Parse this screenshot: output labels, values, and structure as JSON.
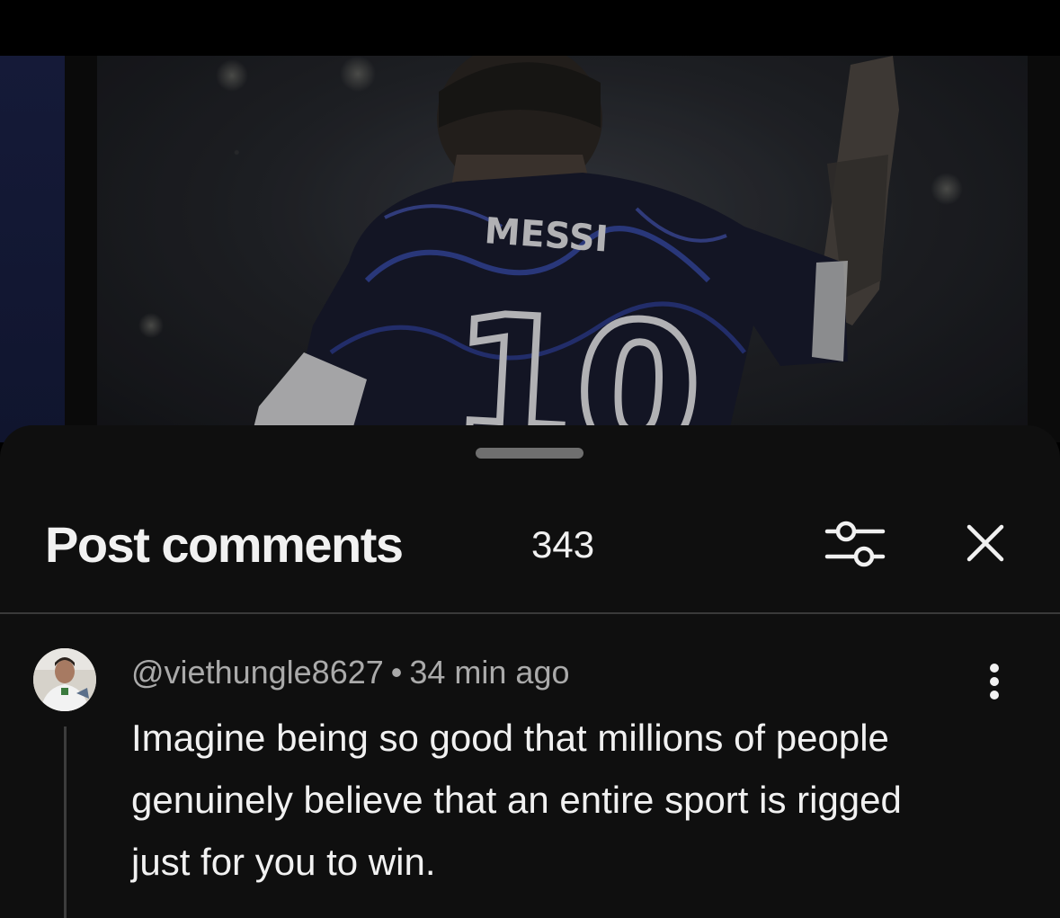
{
  "media": {
    "jersey_name": "MESSI",
    "jersey_number": "10"
  },
  "comments_panel": {
    "title": "Post comments",
    "count": "343"
  },
  "comment": {
    "author": "@viethungle8627",
    "separator": "•",
    "time": "34 min ago",
    "text": "Imagine being so good that millions of people genuinely believe that an entire sport is rigged just for you to win."
  },
  "icons": {
    "filter": "sliders-icon",
    "close": "close-icon",
    "more": "more-vertical-icon"
  },
  "colors": {
    "sheet_bg": "#0f0f0f",
    "primary_text": "#f1f1f1",
    "secondary_text": "#aaaaaa",
    "divider": "#3a3a3a"
  }
}
